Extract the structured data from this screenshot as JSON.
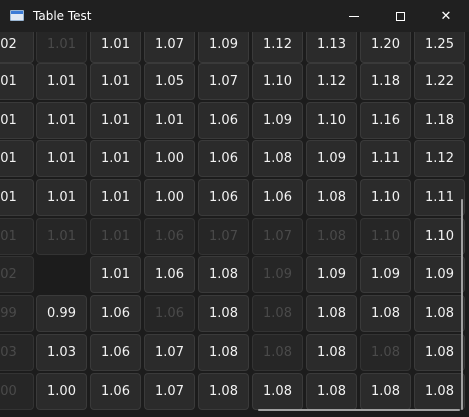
{
  "window": {
    "title": "Table Test",
    "minimize_icon": "minimize-icon",
    "maximize_icon": "maximize-icon",
    "close_icon": "close-icon",
    "close_glyph": "✕"
  },
  "table": {
    "rows": [
      [
        "02",
        "1.01",
        "1.01",
        "1.07",
        "1.09",
        "1.12",
        "1.13",
        "1.20",
        "1.25"
      ],
      [
        "01",
        "1.01",
        "1.01",
        "1.05",
        "1.07",
        "1.10",
        "1.12",
        "1.18",
        "1.22"
      ],
      [
        "01",
        "1.01",
        "1.01",
        "1.01",
        "1.06",
        "1.09",
        "1.10",
        "1.16",
        "1.18"
      ],
      [
        "01",
        "1.01",
        "1.01",
        "1.00",
        "1.06",
        "1.08",
        "1.09",
        "1.11",
        "1.12"
      ],
      [
        "01",
        "1.01",
        "1.01",
        "1.00",
        "1.06",
        "1.06",
        "1.08",
        "1.10",
        "1.11"
      ],
      [
        "01",
        "1.01",
        "1.01",
        "1.06",
        "1.07",
        "1.07",
        "1.08",
        "1.10",
        "1.10"
      ],
      [
        "02",
        "",
        "1.01",
        "1.06",
        "1.08",
        "1.09",
        "1.09",
        "1.09",
        "1.09"
      ],
      [
        "99",
        "0.99",
        "1.06",
        "1.06",
        "1.08",
        "1.08",
        "1.08",
        "1.08",
        "1.08"
      ],
      [
        "03",
        "1.03",
        "1.06",
        "1.07",
        "1.08",
        "1.08",
        "1.08",
        "1.08",
        "1.08"
      ],
      [
        "00",
        "1.00",
        "1.06",
        "1.07",
        "1.08",
        "1.08",
        "1.08",
        "1.08",
        "1.08"
      ]
    ],
    "dimmed": [
      [
        0,
        1
      ],
      [
        5,
        0
      ],
      [
        5,
        1
      ],
      [
        5,
        2
      ],
      [
        5,
        3
      ],
      [
        5,
        4
      ],
      [
        5,
        5
      ],
      [
        5,
        6
      ],
      [
        5,
        7
      ],
      [
        6,
        0
      ],
      [
        6,
        5
      ],
      [
        7,
        0
      ],
      [
        7,
        3
      ],
      [
        7,
        5
      ],
      [
        8,
        0
      ],
      [
        8,
        5
      ],
      [
        8,
        7
      ],
      [
        9,
        0
      ]
    ]
  }
}
